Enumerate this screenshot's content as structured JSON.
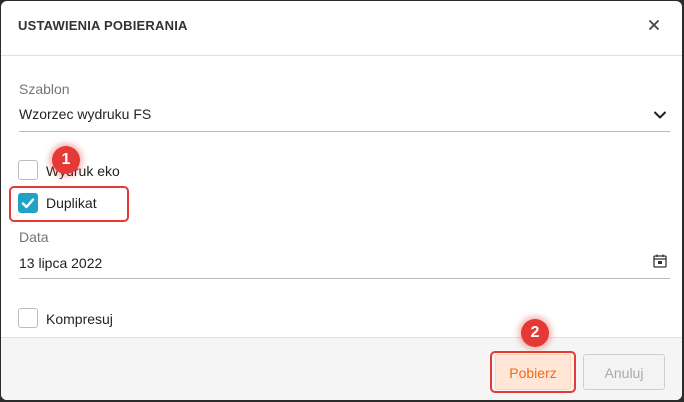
{
  "dialog": {
    "title": "USTAWIENIA POBIERANIA",
    "template": {
      "label": "Szablon",
      "value": "Wzorzec wydruku FS"
    },
    "checkboxes": {
      "eco": {
        "label": "Wydruk eko",
        "checked": false
      },
      "duplicate": {
        "label": "Duplikat",
        "checked": true
      },
      "compress": {
        "label": "Kompresuj",
        "checked": false
      }
    },
    "date": {
      "label": "Data",
      "value": "13 lipca 2022"
    },
    "buttons": {
      "download": "Pobierz",
      "cancel": "Anuluj"
    }
  },
  "annotations": {
    "badge1": "1",
    "badge2": "2"
  },
  "colors": {
    "accent": "#1fa2c6",
    "primary_text": "#f26a1b",
    "highlight": "#e53935"
  },
  "icons": {
    "close": "close-icon",
    "dropdown": "chevron-down-icon",
    "calendar": "calendar-icon",
    "check": "checkmark-icon"
  }
}
